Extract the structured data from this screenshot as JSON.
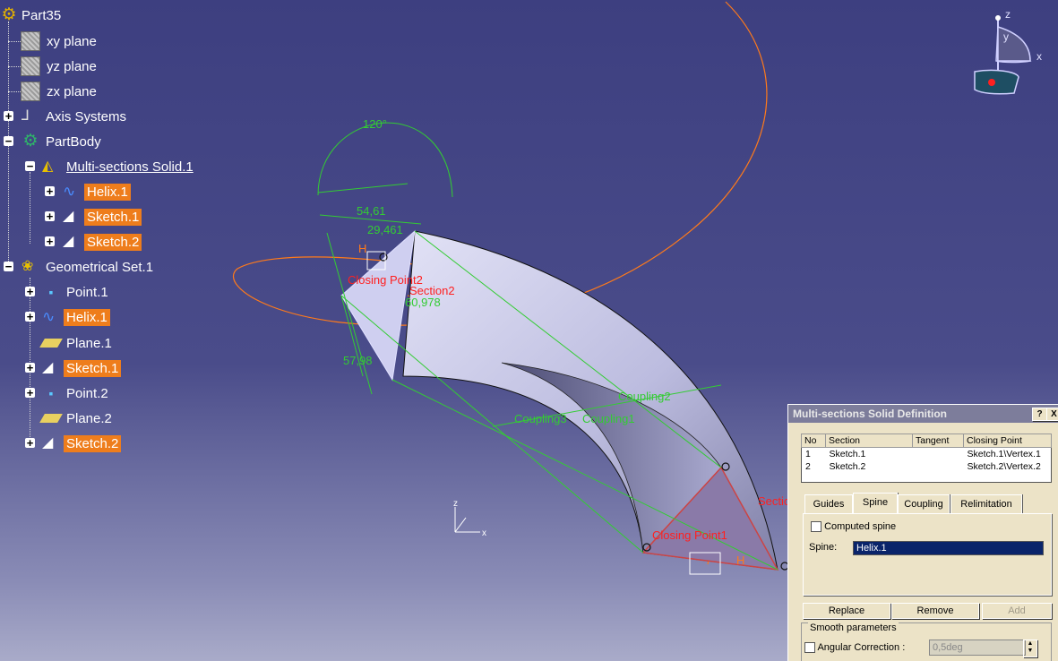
{
  "tree": {
    "root": "Part35",
    "nodes": [
      {
        "label": "xy plane"
      },
      {
        "label": "yz plane"
      },
      {
        "label": "zx plane"
      },
      {
        "label": "Axis Systems"
      },
      {
        "label": "PartBody"
      },
      {
        "label": "Multi-sections Solid.1"
      },
      {
        "label": "Helix.1"
      },
      {
        "label": "Sketch.1"
      },
      {
        "label": "Sketch.2"
      },
      {
        "label": "Geometrical Set.1"
      },
      {
        "label": "Point.1"
      },
      {
        "label": "Helix.1"
      },
      {
        "label": "Plane.1"
      },
      {
        "label": "Sketch.1"
      },
      {
        "label": "Point.2"
      },
      {
        "label": "Plane.2"
      },
      {
        "label": "Sketch.2"
      }
    ]
  },
  "viewport": {
    "dims": {
      "angle": "120°",
      "d1": "54,61",
      "d2": "29,461",
      "d3": "60,978",
      "d4": "57,98"
    },
    "labels": {
      "closing_point2": "Closing Point2",
      "section2": "Section2",
      "coupling2": "Coupling2",
      "coupling3": "Coupling3",
      "coupling1": "Coupling1",
      "closing_point1": "Closing Point1",
      "section1_partial": "Sectio",
      "h1": "H",
      "h2": "H"
    },
    "compass": {
      "z": "z",
      "y": "y",
      "x": "x"
    },
    "mini_axis": {
      "z": "z",
      "x": "x"
    },
    "colors": {
      "background": "#3d3f80",
      "solid": "#c7c7e6",
      "highlight": "#ee7d1c",
      "construction": "#33cc33",
      "helix": "#ff7a1a",
      "red": "#ff2020"
    }
  },
  "dialog": {
    "title": "Multi-sections Solid Definition",
    "help": "?",
    "close": "X",
    "columns": [
      "No",
      "Section",
      "Tangent",
      "Closing Point"
    ],
    "rows": [
      {
        "no": "1",
        "section": "Sketch.1",
        "tangent": "",
        "closing": "Sketch.1\\Vertex.1"
      },
      {
        "no": "2",
        "section": "Sketch.2",
        "tangent": "",
        "closing": "Sketch.2\\Vertex.2"
      }
    ],
    "tabs": [
      "Guides",
      "Spine",
      "Coupling",
      "Relimitation"
    ],
    "active_tab": "Spine",
    "computed_spine": "Computed spine",
    "spine_label": "Spine:",
    "spine_value": "Helix.1",
    "buttons": {
      "replace": "Replace",
      "remove": "Remove",
      "add": "Add"
    },
    "smooth_title": "Smooth parameters",
    "angular_label": "Angular Correction :",
    "angular_value": "0,5deg"
  }
}
